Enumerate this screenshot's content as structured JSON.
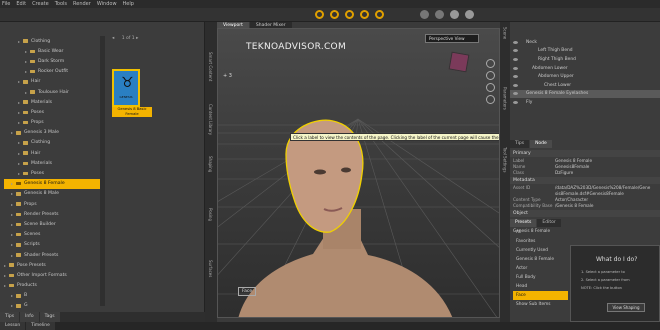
{
  "menubar": {
    "items": [
      "File",
      "Edit",
      "Create",
      "Tools",
      "Render",
      "Window",
      "Help"
    ]
  },
  "left_panel": {
    "tree": [
      {
        "label": "Clothing",
        "indent": 2
      },
      {
        "label": "Basic Wear",
        "indent": 3
      },
      {
        "label": "Dark Storm",
        "indent": 3
      },
      {
        "label": "Rocker Outfit",
        "indent": 3
      },
      {
        "label": "Hair",
        "indent": 2
      },
      {
        "label": "Toulouse Hair",
        "indent": 3
      },
      {
        "label": "Materials",
        "indent": 2
      },
      {
        "label": "Poses",
        "indent": 2
      },
      {
        "label": "Props",
        "indent": 2
      },
      {
        "label": "Genesis 3 Male",
        "indent": 1
      },
      {
        "label": "Clothing",
        "indent": 2
      },
      {
        "label": "Hair",
        "indent": 2
      },
      {
        "label": "Materials",
        "indent": 2
      },
      {
        "label": "Poses",
        "indent": 2
      },
      {
        "label": "Genesis 8 Female",
        "indent": 1,
        "selected": true
      },
      {
        "label": "Genesis 8 Male",
        "indent": 1
      },
      {
        "label": "Props",
        "indent": 1
      },
      {
        "label": "Render Presets",
        "indent": 1
      },
      {
        "label": "Scene Builder",
        "indent": 1
      },
      {
        "label": "Scenes",
        "indent": 1
      },
      {
        "label": "Scripts",
        "indent": 1
      },
      {
        "label": "Shader Presets",
        "indent": 1
      },
      {
        "label": "Pose Presets",
        "indent": 0
      },
      {
        "label": "Other Import Formats",
        "indent": 0
      },
      {
        "label": "Products",
        "indent": 0
      },
      {
        "label": "B",
        "indent": 1
      },
      {
        "label": "G",
        "indent": 1
      }
    ],
    "page_info": "1 of 1",
    "thumbnail": {
      "symbol": "♉",
      "brand": "GENESIS",
      "label": "Genesis 8 Basic Female"
    },
    "bottom_tabs": [
      "Tips",
      "Info",
      "Tags"
    ]
  },
  "viewport": {
    "tabs": [
      "Viewport",
      "Shader Mixer"
    ],
    "watermark": "TEKNOADVISOR.COM",
    "view_mode": "Perspective View",
    "coord": "+ 3",
    "tooltip": "Click a label to view the contents of the page. Clicking the label of the current page will cause the area to minimize",
    "bottom_label": "Face"
  },
  "side_tabs_left": [
    "Smart Content",
    "Content Library",
    "Shaping",
    "Posing",
    "Surfaces"
  ],
  "side_tabs_right": [
    "Scene",
    "Parameters",
    "Tool Settings"
  ],
  "scene": {
    "rows": [
      {
        "label": "Neck",
        "indent": 1
      },
      {
        "label": "Left Thigh Bend",
        "indent": 3
      },
      {
        "label": "Right Thigh Bend",
        "indent": 3
      },
      {
        "label": "Abdomen Lower",
        "indent": 2
      },
      {
        "label": "Abdomen Upper",
        "indent": 3
      },
      {
        "label": "Chest Lower",
        "indent": 4
      },
      {
        "label": "Genesis 8 Female Eyelashes",
        "indent": 1,
        "highlight": true
      },
      {
        "label": "Fly",
        "indent": 1
      }
    ]
  },
  "properties": {
    "tabs": [
      "Tips",
      "Node"
    ],
    "primary": {
      "title": "Primary",
      "rows": [
        {
          "k": "Label",
          "v": "Genesis 8 Female"
        },
        {
          "k": "Name",
          "v": "Genesis8Female"
        },
        {
          "k": "Class",
          "v": "DzFigure"
        }
      ]
    },
    "metadata": {
      "title": "Metadata",
      "rows": [
        {
          "k": "Asset ID",
          "v": "/data/DAZ%203D/Genesis%208/Female/Gene"
        },
        {
          "k": "",
          "v": "sis8Female.dsf#Genesis8Female"
        },
        {
          "k": "Content Type",
          "v": "Actor/Character"
        },
        {
          "k": "Compatibility Base",
          "v": "/Genesis 8 Female"
        }
      ]
    },
    "object_header": "Object",
    "object_tabs": [
      "Presets",
      "Editor"
    ],
    "object_select": "Genesis 8 Female",
    "mini_list": [
      {
        "label": "All"
      },
      {
        "label": "Favorites"
      },
      {
        "label": "Currently Used"
      },
      {
        "label": "Genesis 8 Female"
      },
      {
        "label": "Actor"
      },
      {
        "label": "Full Body"
      },
      {
        "label": "Head"
      },
      {
        "label": "Face",
        "selected": true
      },
      {
        "label": "Show Sub Items"
      }
    ]
  },
  "help": {
    "title": "What do I do?",
    "lines": [
      "1. Select a parameter to",
      "2. Select a parameter from",
      "NOTE: Click the button"
    ],
    "button": "View Shaping"
  },
  "statusbar": {
    "tabs": [
      "Lesson",
      "Timeline"
    ]
  },
  "colors": {
    "accent": "#f3b300",
    "panel": "#3c3c3c",
    "thumb_bg": "#2a7fc2"
  }
}
